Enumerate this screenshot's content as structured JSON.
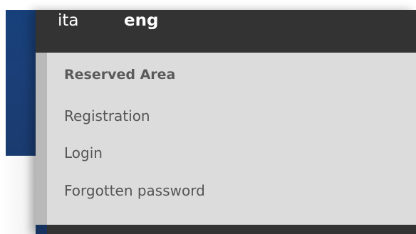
{
  "language_bar": {
    "items": [
      {
        "label": "ita",
        "active": false
      },
      {
        "label": "eng",
        "active": true
      }
    ]
  },
  "menu": {
    "heading": "Reserved Area",
    "items": [
      {
        "label": "Registration"
      },
      {
        "label": "Login"
      },
      {
        "label": "Forgotten password"
      }
    ]
  },
  "colors": {
    "bar_background": "#333333",
    "menu_background": "#dcdcdc",
    "side_stripe": "#b9b9b9",
    "page_blue": "#1b3f78"
  }
}
